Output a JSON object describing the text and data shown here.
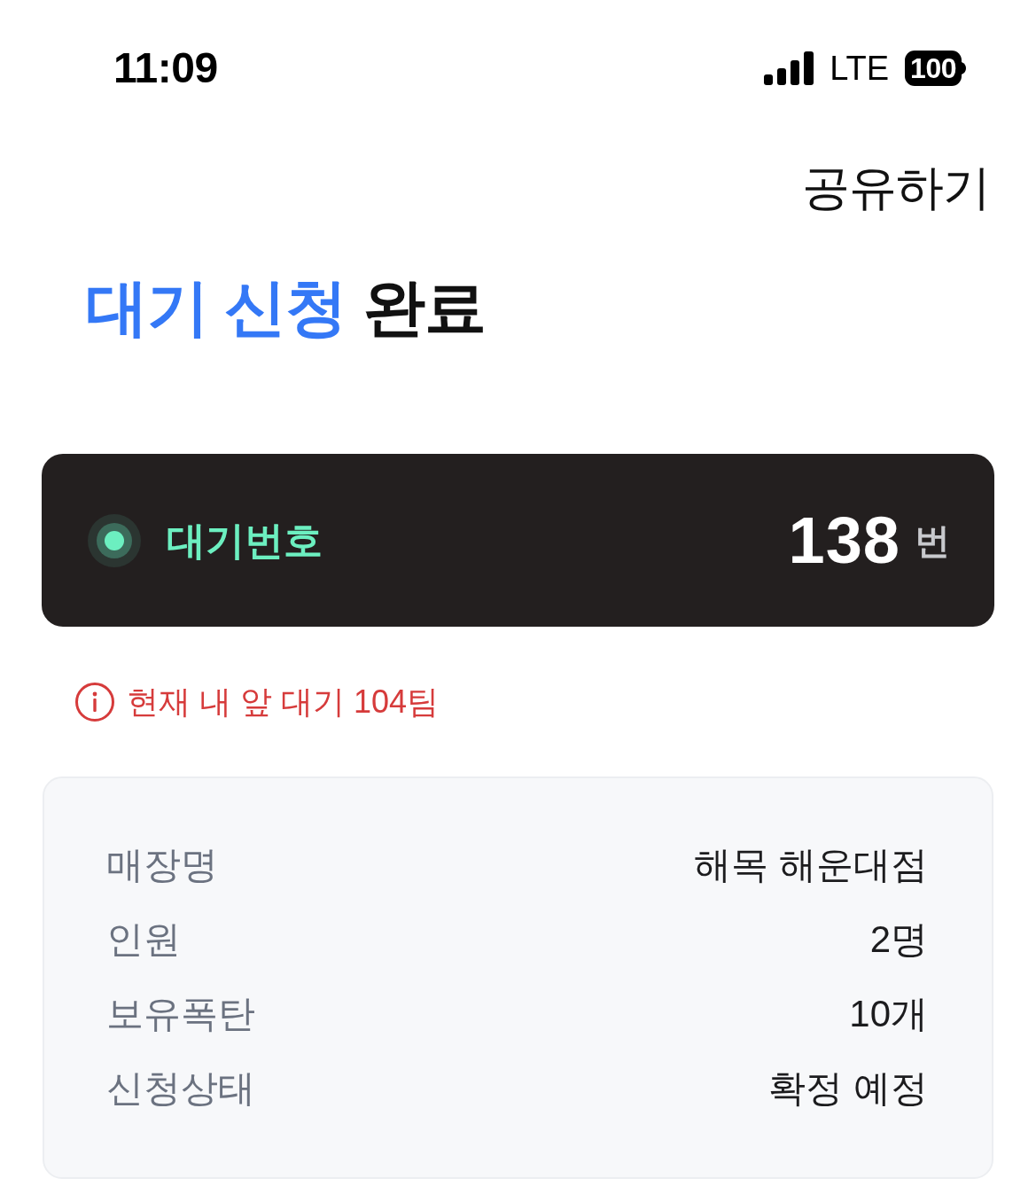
{
  "status_bar": {
    "time": "11:09",
    "network": "LTE",
    "battery": "100"
  },
  "header": {
    "action": "공유하기"
  },
  "title": {
    "accent": "대기 신청",
    "text": "완료"
  },
  "queue_card": {
    "label": "대기번호",
    "number": "138",
    "unit": "번"
  },
  "notice": "현재 내 앞 대기 104팀",
  "details": [
    {
      "label": "매장명",
      "value": "해목 해운대점"
    },
    {
      "label": "인원",
      "value": "2명"
    },
    {
      "label": "보유폭탄",
      "value": "10개"
    },
    {
      "label": "신청상태",
      "value": "확정 예정"
    }
  ]
}
